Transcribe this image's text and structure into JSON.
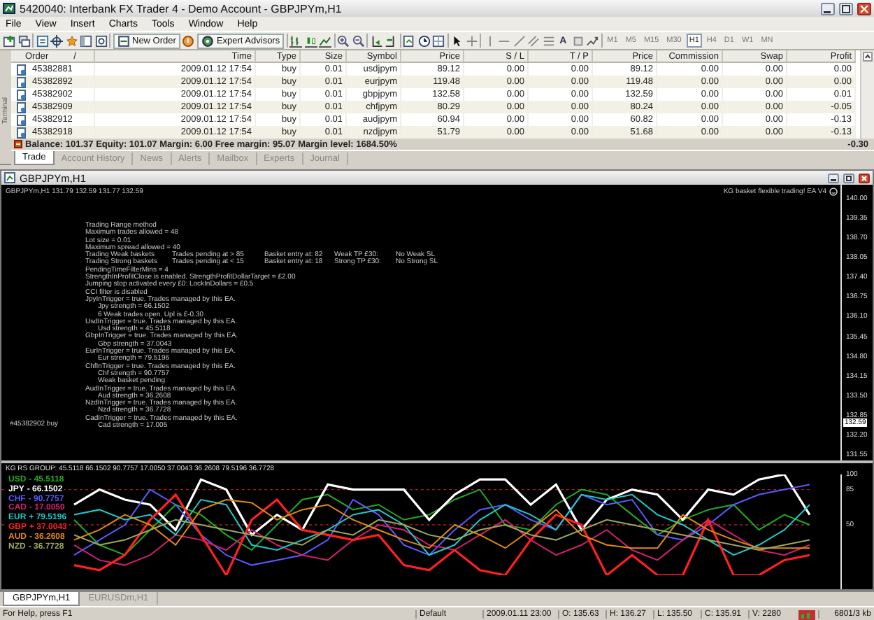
{
  "window": {
    "title": "5420040: Interbank FX Trader 4 - Demo Account - GBPJPYm,H1"
  },
  "menu": [
    "File",
    "View",
    "Insert",
    "Charts",
    "Tools",
    "Window",
    "Help"
  ],
  "toolbar": {
    "new_order": "New Order",
    "expert_advisors": "Expert Advisors",
    "text_tool": "A",
    "timeframes": [
      {
        "label": "M1",
        "selected": false
      },
      {
        "label": "M5",
        "selected": false
      },
      {
        "label": "M15",
        "selected": false
      },
      {
        "label": "M30",
        "selected": false
      },
      {
        "label": "H1",
        "selected": true
      },
      {
        "label": "H4",
        "selected": false
      },
      {
        "label": "D1",
        "selected": false
      },
      {
        "label": "W1",
        "selected": false
      },
      {
        "label": "MN",
        "selected": false
      }
    ]
  },
  "terminal": {
    "side_label": "Terminal",
    "sort_mark": "/",
    "columns": [
      "Order",
      "Time",
      "Type",
      "Size",
      "Symbol",
      "Price",
      "S / L",
      "T / P",
      "Price",
      "Commission",
      "Swap",
      "Profit"
    ],
    "rows": [
      [
        "45382881",
        "2009.01.12 17:54",
        "buy",
        "0.01",
        "usdjpym",
        "89.12",
        "0.00",
        "0.00",
        "89.12",
        "0.00",
        "0.00",
        "0.00"
      ],
      [
        "45382892",
        "2009.01.12 17:54",
        "buy",
        "0.01",
        "eurjpym",
        "119.48",
        "0.00",
        "0.00",
        "119.48",
        "0.00",
        "0.00",
        "0.00"
      ],
      [
        "45382902",
        "2009.01.12 17:54",
        "buy",
        "0.01",
        "gbpjpym",
        "132.58",
        "0.00",
        "0.00",
        "132.59",
        "0.00",
        "0.00",
        "0.01"
      ],
      [
        "45382909",
        "2009.01.12 17:54",
        "buy",
        "0.01",
        "chfjpym",
        "80.29",
        "0.00",
        "0.00",
        "80.24",
        "0.00",
        "0.00",
        "-0.05"
      ],
      [
        "45382912",
        "2009.01.12 17:54",
        "buy",
        "0.01",
        "audjpym",
        "60.94",
        "0.00",
        "0.00",
        "60.82",
        "0.00",
        "0.00",
        "-0.13"
      ],
      [
        "45382918",
        "2009.01.12 17:54",
        "buy",
        "0.01",
        "nzdjpym",
        "51.79",
        "0.00",
        "0.00",
        "51.68",
        "0.00",
        "0.00",
        "-0.13"
      ]
    ],
    "summary": {
      "text": "Balance: 101.37  Equity: 101.07  Margin: 6.00  Free margin: 95.07  Margin level: 1684.50%",
      "profit": "-0.30"
    },
    "tabs": [
      {
        "label": "Trade",
        "selected": true
      },
      {
        "label": "Account History",
        "selected": false
      },
      {
        "label": "News",
        "selected": false
      },
      {
        "label": "Alerts",
        "selected": false
      },
      {
        "label": "Mailbox",
        "selected": false
      },
      {
        "label": "Experts",
        "selected": false
      },
      {
        "label": "Journal",
        "selected": false
      }
    ]
  },
  "chart": {
    "title": "GBPJPYm,H1",
    "header": "GBPJPYm,H1  131.79 132.59 131.77 132.59",
    "ea_label": "KG basket flexible trading! EA V4",
    "order_marker": "#45382902 buy",
    "comment": [
      {
        "cells": [
          "Trading Range method"
        ]
      },
      {
        "cells": [
          "Maximum trades allowed = 48"
        ]
      },
      {
        "cells": [
          "Lot size = 0.01"
        ]
      },
      {
        "cells": [
          "Maximum spread allowed = 40"
        ]
      },
      {
        "cells": [
          "Trading Weak baskets",
          "Trades pending at > 85",
          "Basket entry at: 82",
          "Weak TP £30:",
          "No Weak SL"
        ]
      },
      {
        "cells": [
          "Trading Strong baskets",
          "Trades pending at < 15",
          "Basket entry at: 18",
          "Strong TP £30:",
          "No Strong SL"
        ]
      },
      {
        "cells": [
          "PendingTimeFilterMins = 4"
        ]
      },
      {
        "cells": [
          "StrengthInProfitClose is enabled. StrengthProfitDollarTarget = £2.00"
        ]
      },
      {
        "cells": [
          "Jumping stop activated every £0: LockInDollars = £0.5"
        ]
      },
      {
        "cells": [
          "CCI filter is disabled"
        ]
      },
      {
        "cells": [
          "JpyInTrigger = true.  Trades managed by this EA."
        ],
        "children": [
          "Jpy strength = 66.1502",
          "6 Weak trades open. Upl is £-0.30"
        ]
      },
      {
        "cells": [
          "UsdInTrigger = true.  Trades managed by this EA."
        ],
        "children": [
          "Usd strength = 45.5118"
        ]
      },
      {
        "cells": [
          "GbpInTrigger = true.  Trades managed by this EA."
        ],
        "children": [
          "Gbp strength = 37.0043"
        ]
      },
      {
        "cells": [
          "EurInTrigger = true.  Trades managed by this EA."
        ],
        "children": [
          "Eur strength = 79.5196"
        ]
      },
      {
        "cells": [
          "ChfInTrigger = true.  Trades managed by this EA."
        ],
        "children": [
          "Chf strength = 90.7757",
          "Weak basket pending"
        ]
      },
      {
        "cells": [
          "AudInTrigger = true.  Trades managed by this EA."
        ],
        "children": [
          "Aud strength = 36.2608"
        ]
      },
      {
        "cells": [
          "NzdInTrigger = true.  Trades managed by this EA."
        ],
        "children": [
          "Nzd strength = 36.7728"
        ]
      },
      {
        "cells": [
          "CadInTrigger = true.  Trades managed by this EA."
        ],
        "children": [
          "Cad strength = 17.005"
        ]
      }
    ],
    "price_ticks": [
      "140.00",
      "139.35",
      "138.70",
      "138.05",
      "137.40",
      "136.75",
      "136.10",
      "135.45",
      "134.80",
      "134.15",
      "133.50",
      "132.85",
      "132.20",
      "131.55"
    ],
    "current_price": "132.59",
    "indicator": {
      "header": "KG RS GROUP:  45.5118 66.1502 90.7757 17.0050 37.0043 36.2608 79.5196 36.7728",
      "chart_data": {
        "type": "line",
        "ylim": [
          0,
          100
        ],
        "yticks": [
          100,
          85,
          50
        ],
        "series": [
          {
            "name": "USD",
            "color": "#22aa22",
            "values": [
              55,
              30,
              20,
              45,
              70,
              60,
              40,
              25,
              50,
              75,
              80,
              65,
              70,
              55,
              60,
              75,
              85,
              50,
              45,
              70,
              85,
              80,
              60,
              40,
              55,
              65,
              70,
              45,
              60,
              50
            ]
          },
          {
            "name": "JPY",
            "color": "#ffffff",
            "values": [
              70,
              85,
              75,
              70,
              45,
              95,
              85,
              40,
              60,
              45,
              90,
              85,
              85,
              85,
              55,
              80,
              95,
              95,
              70,
              90,
              45,
              75,
              85,
              80,
              55,
              85,
              80,
              95,
              100,
              60
            ]
          },
          {
            "name": "CHF",
            "color": "#5a5aff",
            "values": [
              20,
              35,
              50,
              85,
              70,
              40,
              20,
              10,
              15,
              20,
              35,
              75,
              60,
              30,
              20,
              45,
              65,
              70,
              55,
              45,
              80,
              70,
              75,
              40,
              35,
              50,
              70,
              80,
              85,
              90
            ]
          },
          {
            "name": "CAD",
            "color": "#d02070",
            "values": [
              30,
              15,
              10,
              20,
              40,
              35,
              25,
              45,
              30,
              20,
              15,
              35,
              50,
              45,
              30,
              25,
              40,
              55,
              35,
              20,
              30,
              45,
              25,
              15,
              35,
              55,
              40,
              25,
              20,
              30
            ]
          },
          {
            "name": "EUR",
            "color": "#22c8c8",
            "values": [
              60,
              65,
              55,
              60,
              40,
              75,
              70,
              30,
              25,
              35,
              45,
              60,
              65,
              50,
              20,
              30,
              55,
              70,
              60,
              45,
              80,
              75,
              80,
              60,
              50,
              35,
              20,
              30,
              45,
              70
            ]
          },
          {
            "name": "GBP",
            "color": "#ff2020",
            "values": [
              10,
              5,
              20,
              55,
              80,
              40,
              0,
              55,
              75,
              45,
              40,
              35,
              40,
              10,
              5,
              25,
              5,
              0,
              35,
              60,
              50,
              0,
              20,
              0,
              0,
              55,
              0,
              0,
              15,
              20
            ]
          },
          {
            "name": "AUD",
            "color": "#e08a10",
            "values": [
              35,
              45,
              60,
              50,
              30,
              65,
              75,
              72,
              55,
              65,
              70,
              55,
              45,
              35,
              27,
              50,
              40,
              27,
              45,
              65,
              40,
              30,
              27,
              27,
              60,
              45,
              35,
              27,
              27,
              27
            ]
          },
          {
            "name": "NZD",
            "color": "#9aaa5a",
            "values": [
              40,
              30,
              35,
              45,
              55,
              50,
              45,
              40,
              35,
              30,
              45,
              40,
              55,
              50,
              40,
              35,
              45,
              50,
              40,
              35,
              45,
              55,
              50,
              45,
              40,
              35,
              30,
              25,
              30,
              35
            ]
          }
        ]
      },
      "legend": [
        {
          "reading": "- 45.5118"
        },
        {
          "reading": "- 66.1502"
        },
        {
          "reading": "- 90.7757"
        },
        {
          "reading": "- 17.0050"
        },
        {
          "reading": "+ 79.5196"
        },
        {
          "reading": "+ 37.0043"
        },
        {
          "reading": "- 36.2608"
        },
        {
          "reading": "- 36.7728"
        }
      ]
    }
  },
  "chart_tabs": [
    {
      "label": "GBPJPYm,H1",
      "selected": true
    },
    {
      "label": "EURUSDm,H1",
      "selected": false
    }
  ],
  "status_bar": [
    "For Help, press F1",
    "Default",
    "2009.01.11 23:00",
    "O: 135.63",
    "H: 136.27",
    "L: 135.50",
    "C: 135.91",
    "V: 2280",
    "6801/3 kb"
  ]
}
